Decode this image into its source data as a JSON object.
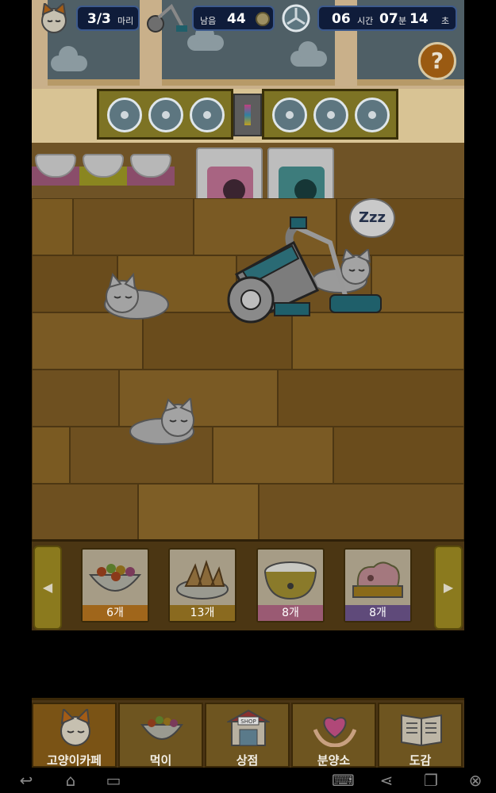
{
  "hud": {
    "cat_count": "3/3",
    "cat_unit": "마리",
    "remaining_label": "남음",
    "remaining_value": "44",
    "time_hours": "06",
    "time_hours_label": "시간",
    "time_minutes": "07",
    "time_minutes_label": "분",
    "time_seconds": "14",
    "time_seconds_label": "초",
    "help_label": "?"
  },
  "scene": {
    "zzz_text": "Zzz"
  },
  "tray": {
    "left_arrow": "◀",
    "right_arrow": "▶",
    "items": [
      {
        "name": "mixed-kibble",
        "count": "6개",
        "band_color": "#a0661b"
      },
      {
        "name": "dried-fish",
        "count": "13개",
        "band_color": "#8a6a1f"
      },
      {
        "name": "milk-bowl",
        "count": "8개",
        "band_color": "#9a5a73"
      },
      {
        "name": "meat-slab",
        "count": "8개",
        "band_color": "#5f4a7a"
      }
    ]
  },
  "nav": {
    "items": [
      {
        "label": "고양이카페",
        "icon": "cat-face-icon"
      },
      {
        "label": "먹이",
        "icon": "food-bowl-icon"
      },
      {
        "label": "상점",
        "icon": "shop-icon",
        "sign": "SHOP"
      },
      {
        "label": "분양소",
        "icon": "heart-hands-icon"
      },
      {
        "label": "도감",
        "icon": "book-icon"
      }
    ]
  },
  "system_bar": {
    "icons": [
      "back-icon",
      "home-icon",
      "recents-icon",
      "keyboard-icon",
      "share-icon",
      "window-icon",
      "close-icon"
    ]
  },
  "colors": {
    "hud_pill": "#0f1c3a",
    "help_button": "#9a5a12",
    "floor": "#6b4e1e"
  }
}
